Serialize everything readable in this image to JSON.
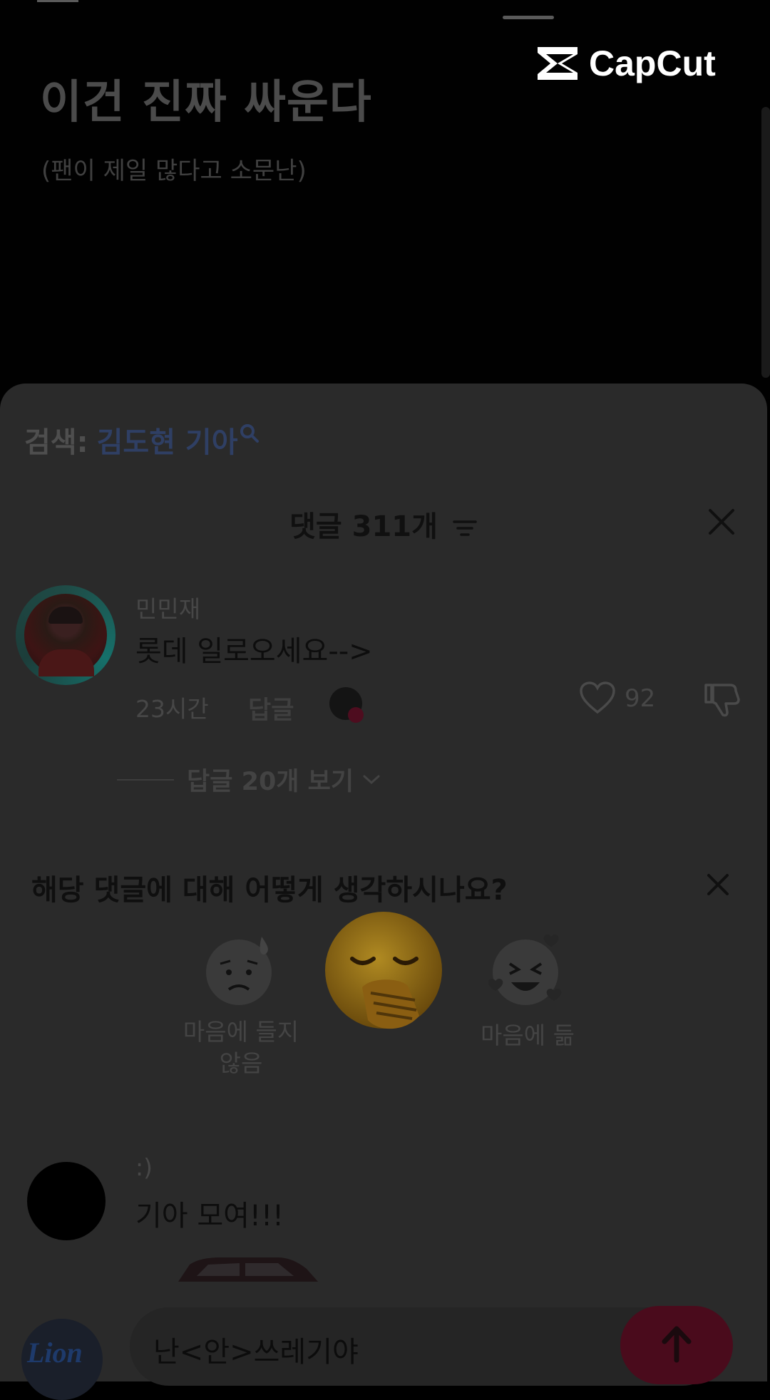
{
  "video": {
    "title": "이건 진짜 싸운다",
    "subtitle": "(팬이 제일 많다고 소문난)",
    "brand": "CapCut"
  },
  "search": {
    "prefix": "검색:",
    "term": "김도현 기아"
  },
  "comments_header": {
    "title": "댓글 311개"
  },
  "comments": [
    {
      "user": "민민재",
      "text": "롯데 일로오세요-->",
      "time": "23시간",
      "reply_label": "답글",
      "likes": "92",
      "view_replies": "답글 20개 보기"
    },
    {
      "user": ":)",
      "text": "기아 모여!!!"
    }
  ],
  "survey": {
    "question": "해당 댓글에 대해 어떻게 생각하시나요?",
    "dislike_label": "마음에 들지 않음",
    "like_label": "마음에 듦"
  },
  "composer": {
    "text": "난<안>쓰레기야",
    "avatar_text": "Lion"
  },
  "colors": {
    "sheet_bg": "#2a2a2a",
    "search_term": "#2f3f64",
    "send_button": "#4a0b1c"
  }
}
